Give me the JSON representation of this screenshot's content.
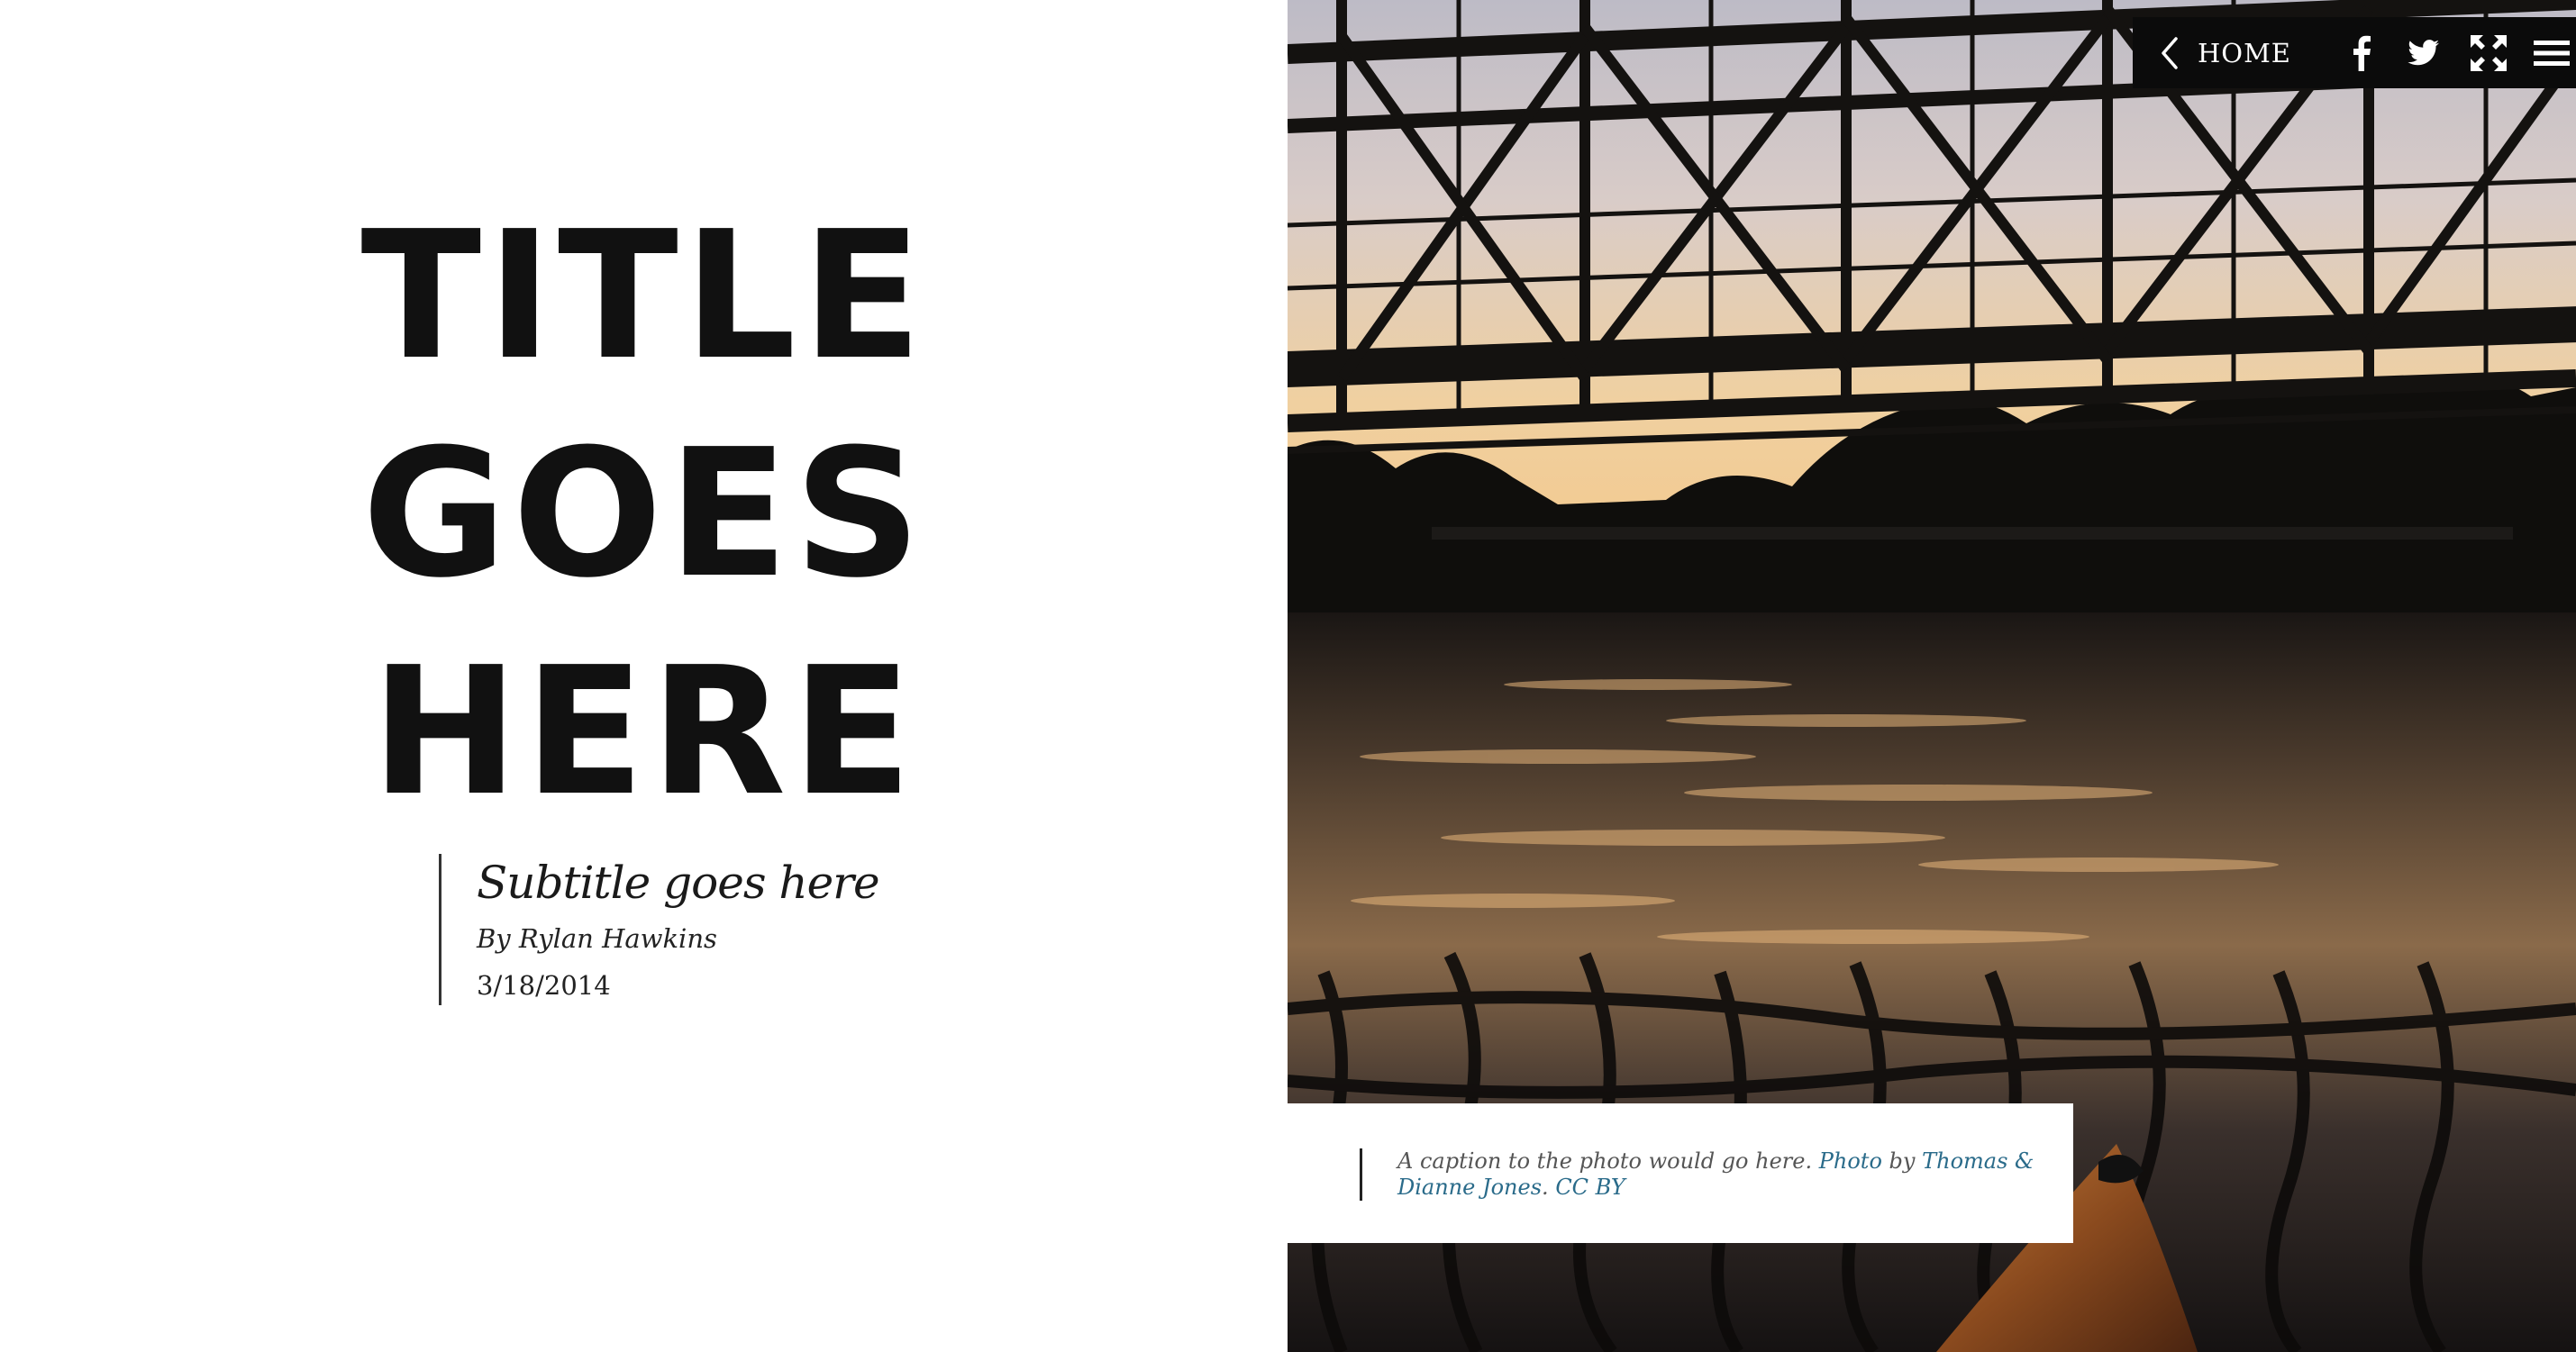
{
  "article": {
    "title_lines": [
      "TITLE",
      "GOES",
      "HERE"
    ],
    "subtitle": "Subtitle goes here",
    "byline": "By Rylan Hawkins",
    "date": "3/18/2014"
  },
  "nav": {
    "home_label": "HOME",
    "icons": [
      "chevron-left-icon",
      "facebook-icon",
      "twitter-icon",
      "fullscreen-icon",
      "hamburger-menu-icon"
    ]
  },
  "caption": {
    "text": "A caption to the photo would go here.",
    "photo_link": "Photo",
    "by": "by",
    "author_link": "Thomas & Dianne Jones",
    "period": ".",
    "license_link": "CC BY"
  },
  "colors": {
    "title": "#111111",
    "nav_bg": "#0b0b0b",
    "link": "#2a6b8a",
    "sky_top": "#c9c6cf",
    "sky_glow": "#f2c98e"
  }
}
